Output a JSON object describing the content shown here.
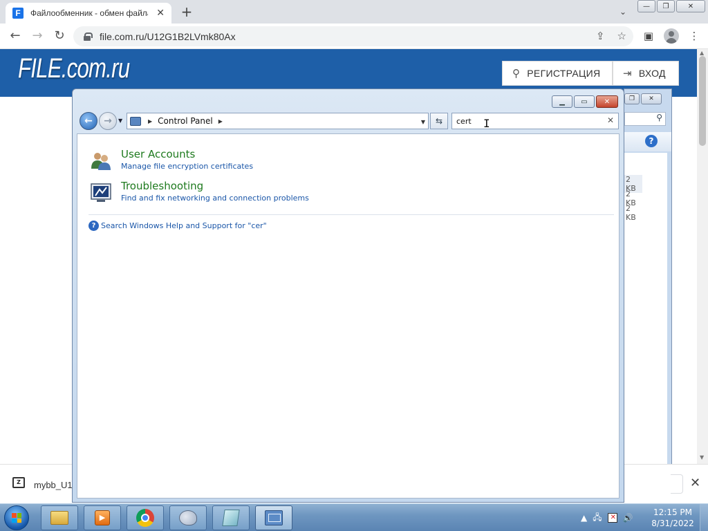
{
  "browser": {
    "tab_title": "Файлообменник - обмен файлами",
    "tab_favicon": "F",
    "new_tab_label": "+",
    "url": "file.com.ru/U12G1B2LVmk80Ax",
    "window_controls": {
      "minimize": "—",
      "maximize": "❐",
      "close": "✕"
    }
  },
  "site": {
    "logo": "FILE.com.ru",
    "register_button": "РЕГИСТРАЦИЯ",
    "login_button": "ВХОД",
    "file_sizes": [
      "2 KB",
      "2 KB",
      "2 KB"
    ]
  },
  "downloads": {
    "file_name": "mybb_U1",
    "file_icon_letter": "Z"
  },
  "control_panel": {
    "breadcrumb": "Control Panel",
    "search_value": "cert",
    "results": [
      {
        "title": "User Accounts",
        "subtitle": "Manage file encryption certificates",
        "icon": "user-accounts-icon"
      },
      {
        "title": "Troubleshooting",
        "subtitle": "Find and fix networking and connection problems",
        "icon": "troubleshooting-icon"
      }
    ],
    "help_link": "Search Windows Help and Support for \"cer\""
  },
  "taskbar": {
    "apps": [
      "windows-explorer-icon",
      "media-center-icon",
      "chrome-icon",
      "paint-icon",
      "sticky-notes-icon",
      "control-panel-icon"
    ],
    "clock_time": "12:15 PM",
    "clock_date": "8/31/2022"
  },
  "colors": {
    "site_header": "#1e5fa8",
    "result_title": "#1e7a1e",
    "result_link": "#1a56a8"
  }
}
